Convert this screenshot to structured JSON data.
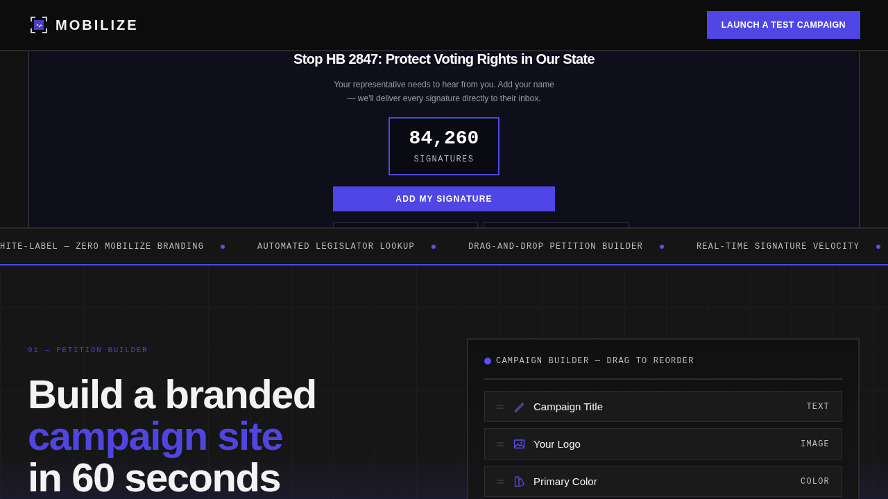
{
  "navbar": {
    "brand": "MOBILIZE",
    "cta": "LAUNCH A TEST CAMPAIGN"
  },
  "preview": {
    "title": "Stop HB 2847: Protect Voting Rights in Our State",
    "description": "Your representative needs to hear from you. Add your name — we'll deliver every signature directly to their inbox.",
    "counter": {
      "value": "84,260",
      "label": "SIGNATURES"
    },
    "button": "ADD MY SIGNATURE",
    "form_fields": [
      {
        "kind": "input"
      },
      {
        "kind": "input"
      }
    ]
  },
  "ticker": {
    "items": [
      "HITE-LABEL — ZERO MOBILIZE BRANDING",
      "AUTOMATED LEGISLATOR LOOKUP",
      "DRAG-AND-DROP PETITION BUILDER",
      "REAL-TIME SIGNATURE VELOCITY"
    ]
  },
  "feature": {
    "eyebrow": "01 — PETITION BUILDER",
    "heading_lines": [
      {
        "text": "Build a branded",
        "accent": false
      },
      {
        "text": "campaign site",
        "accent": true
      },
      {
        "text": "in 60 seconds",
        "accent": false
      }
    ],
    "builder": {
      "title": "CAMPAIGN BUILDER — DRAG TO REORDER",
      "fields": [
        {
          "kind": "text",
          "label": "Campaign Title",
          "tag": "TEXT"
        },
        {
          "kind": "image",
          "label": "Your Logo",
          "tag": "IMAGE"
        },
        {
          "kind": "color",
          "label": "Primary Color",
          "tag": "COLOR"
        }
      ]
    }
  }
}
